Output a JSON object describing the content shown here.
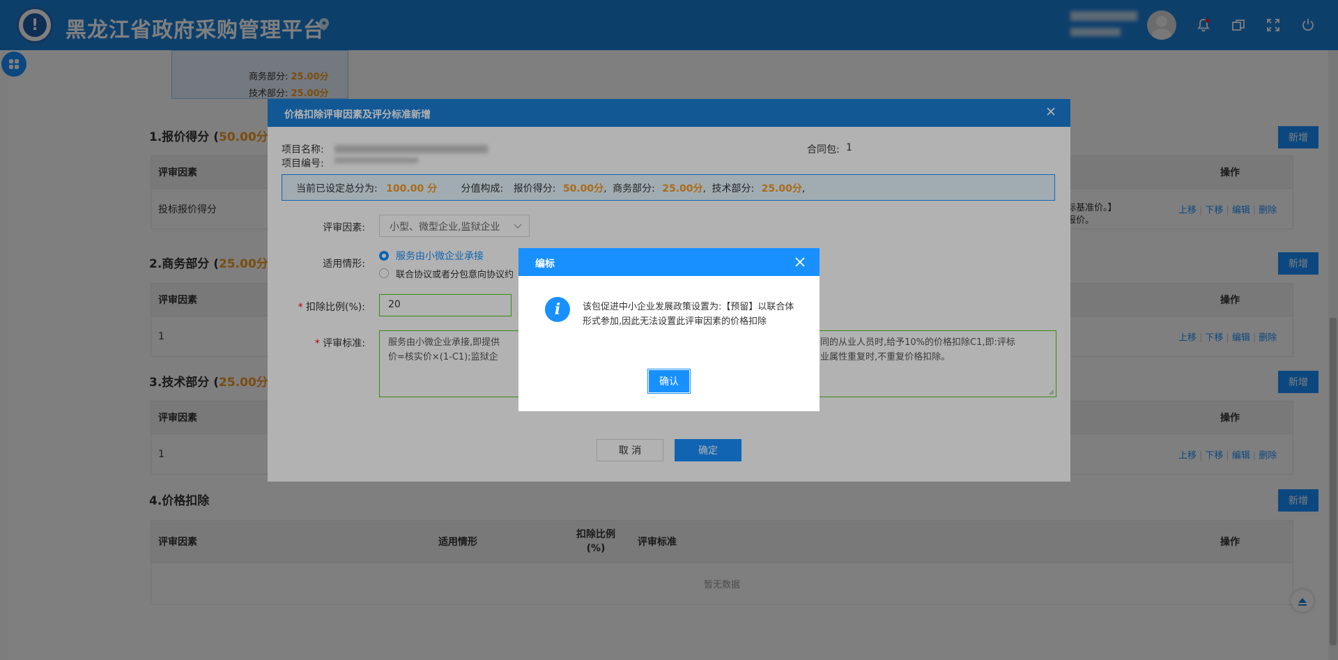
{
  "header": {
    "title": "黑龙江省政府采购管理平台",
    "logo_text": "!"
  },
  "summary_box": {
    "business_label": "商务部分:",
    "business_value": "25.00分",
    "tech_label": "技术部分:",
    "tech_value": "25.00分"
  },
  "sections": [
    {
      "index": "1.",
      "title": "报价得分",
      "score_open": "(",
      "score": "50.00分",
      "score_close": ")",
      "add_label": "新增"
    },
    {
      "index": "2.",
      "title": "商务部分",
      "score_open": "(",
      "score": "25.00分",
      "score_close": ")",
      "add_label": "新增"
    },
    {
      "index": "3.",
      "title": "技术部分",
      "score_open": "(",
      "score": "25.00分",
      "score_close": ")",
      "add_label": "新增"
    },
    {
      "index": "4.",
      "title": "价格扣除",
      "add_label": "新增"
    }
  ],
  "table": {
    "col_factor": "评审因素",
    "col_situation": "适用情形",
    "col_ratio_line1": "扣除比例",
    "col_ratio_line2": "(%)",
    "col_standard": "评审标准",
    "col_ops": "操作",
    "row1_factor": "投标报价得分",
    "row1_right_text1": "标基准价。】",
    "row1_right_text2": "报价。",
    "row2_factor": "1",
    "row3_factor": "1",
    "empty_text": "暂无数据"
  },
  "ops": {
    "up": "上移",
    "down": "下移",
    "edit": "编辑",
    "delete": "删除"
  },
  "dialog": {
    "title": "价格扣除评审因素及评分标准新增",
    "project_name_label": "项目名称:",
    "project_no_label": "项目编号:",
    "contract_label": "合同包:",
    "contract_value": "1",
    "info_total_label": "当前已设定总分为:",
    "info_total_value": "100.00 分",
    "info_comp_label": "分值构成:",
    "info_price_label": "报价得分:",
    "info_price_value": "50.00分",
    "info_sep1": ",",
    "info_biz_label": "商务部分:",
    "info_biz_value": "25.00分",
    "info_sep2": ",",
    "info_tech_label": "技术部分:",
    "info_tech_value": "25.00分",
    "info_sep3": ",",
    "factor_label": "评审因素:",
    "factor_value": "小型、微型企业,监狱企业",
    "situation_label": "适用情形:",
    "radio1": "服务由小微企业承接",
    "radio2": "联合协议或者分包意向协议约",
    "ratio_label": "扣除比例(%):",
    "ratio_value": "20",
    "standard_label": "评审标准:",
    "standard_text_left": "服务由小微企业承接,即提供",
    "standard_text_right": "同的从业人员时,给予10%的价格扣除C1,即:评标",
    "standard_text_line2_left": "价=核实价×(1-C1);监狱企",
    "standard_text_line2_right": "业属性重复时,不重复价格扣除。",
    "cancel_label": "取 消",
    "ok_label": "确定"
  },
  "alert": {
    "title": "编标",
    "icon": "i",
    "message": "该包促进中小企业发展政策设置为:【预留】以联合体形式参加,因此无法设置此评审因素的价格扣除",
    "ok_label": "确认"
  }
}
